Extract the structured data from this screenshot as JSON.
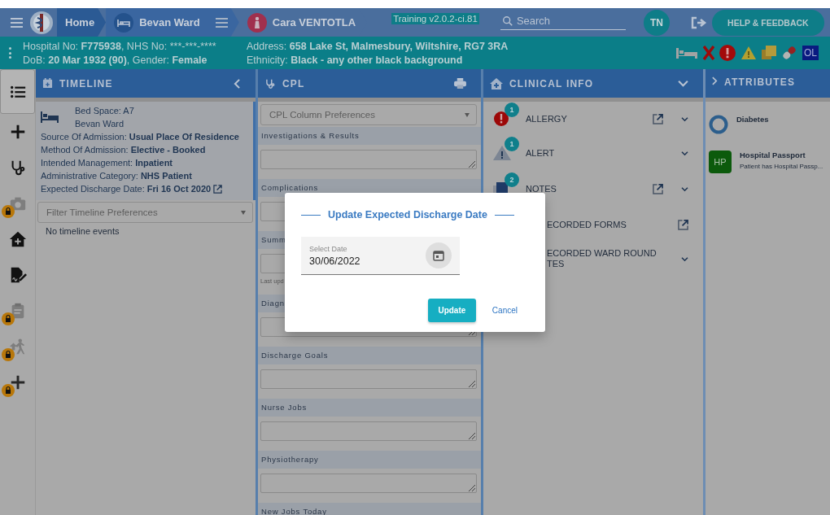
{
  "header": {
    "breadcrumbs": [
      {
        "label": "Home",
        "kind": "home"
      },
      {
        "label": "Bevan Ward",
        "kind": "ward"
      },
      {
        "label": "Cara VENTOTLA",
        "kind": "patient"
      }
    ],
    "build_tag": "Training v2.0.2-ci.81",
    "search": {
      "placeholder": "Search"
    },
    "avatar": "TN",
    "help_button": "HELP & FEEDBACK"
  },
  "patient": {
    "lines": [
      [
        {
          "text": "Hospital No: ",
          "bold": false
        },
        {
          "text": "F775938",
          "bold": true
        },
        {
          "text": ", NHS No: ",
          "bold": false
        },
        {
          "text": "***-***-****",
          "bold": false
        }
      ],
      [
        {
          "text": "DoB: ",
          "bold": false
        },
        {
          "text": "20 Mar 1932 (90)",
          "bold": true
        },
        {
          "text": ", Gender: ",
          "bold": false
        },
        {
          "text": "Female",
          "bold": true
        }
      ],
      [
        {
          "text": "Address: ",
          "bold": false
        },
        {
          "text": "658 Lake St, Malmesbury, Wiltshire, RG7 3RA",
          "bold": true
        }
      ],
      [
        {
          "text": "Ethnicity: ",
          "bold": false
        },
        {
          "text": "Black - any other black background",
          "bold": true
        }
      ]
    ],
    "flag_badge": "OL"
  },
  "rail": [
    {
      "kind": "list",
      "selected": true,
      "locked": false
    },
    {
      "kind": "plus",
      "selected": false,
      "locked": false
    },
    {
      "kind": "stethoscope",
      "selected": false,
      "locked": false
    },
    {
      "kind": "camera",
      "selected": false,
      "locked": true
    },
    {
      "kind": "house",
      "selected": false,
      "locked": false
    },
    {
      "kind": "signature",
      "selected": false,
      "locked": false
    },
    {
      "kind": "clipboard",
      "selected": false,
      "locked": true
    },
    {
      "kind": "runner",
      "selected": false,
      "locked": true
    },
    {
      "kind": "plus",
      "selected": false,
      "locked": true
    }
  ],
  "timeline": {
    "title": "TIMELINE",
    "bed_space": "Bed Space: A7",
    "ward": "Bevan Ward",
    "details": [
      "Source Of Admission: **Usual Place Of Residence**",
      "Method Of Admission: **Elective - Booked**",
      "Intended Management: **Inpatient**",
      "Administrative Category: **NHS Patient**",
      "Expected Discharge Date: **Fri 16 Oct 2020**"
    ],
    "filter": {
      "placeholder": "Filter Timeline Preferences"
    },
    "empty_text": "No timeline events"
  },
  "cpl": {
    "title": "CPL",
    "dropdown": {
      "placeholder": "CPL Column Preferences"
    },
    "sections": [
      {
        "label": "Investigations & Results"
      },
      {
        "label": "Complications"
      },
      {
        "label": "Summ",
        "note": "Last upd"
      },
      {
        "label": "Diagn"
      },
      {
        "label": "Discharge Goals"
      },
      {
        "label": "Nurse Jobs"
      },
      {
        "label": "Physiotherapy"
      },
      {
        "label": "New Jobs Today"
      }
    ]
  },
  "clinical": {
    "title": "CLINICAL INFO",
    "items": [
      {
        "kind": "allergy",
        "lines": [
          "ALLERGY"
        ],
        "count": "1",
        "link": true,
        "chevron": true
      },
      {
        "kind": "alert",
        "lines": [
          "ALERT"
        ],
        "count": "1",
        "link": false,
        "chevron": true
      },
      {
        "kind": "notes",
        "lines": [
          "NOTES"
        ],
        "count": "2",
        "link": true,
        "chevron": true
      },
      {
        "kind": "covered",
        "lines": [
          "ECORDED FORMS"
        ],
        "link": true,
        "chevron": false
      },
      {
        "kind": "covered",
        "lines": [
          "ECORDED WARD ROUND",
          "TES"
        ],
        "link": false,
        "chevron": true
      }
    ]
  },
  "attributes": {
    "title": "ATTRIBUTES",
    "items": [
      {
        "kind": "ring",
        "name": "Diabetes"
      },
      {
        "kind": "badge",
        "badge": "HP",
        "name": "Hospital Passport",
        "detail": "Patient has Hospital Passp..."
      }
    ]
  },
  "dialog": {
    "title": "Update Expected Discharge Date",
    "date_field": {
      "label": "Select Date",
      "value": "30/06/2022"
    },
    "buttons": [
      {
        "label": "Update",
        "kind": "primary"
      },
      {
        "label": "Cancel",
        "kind": "text"
      }
    ]
  }
}
